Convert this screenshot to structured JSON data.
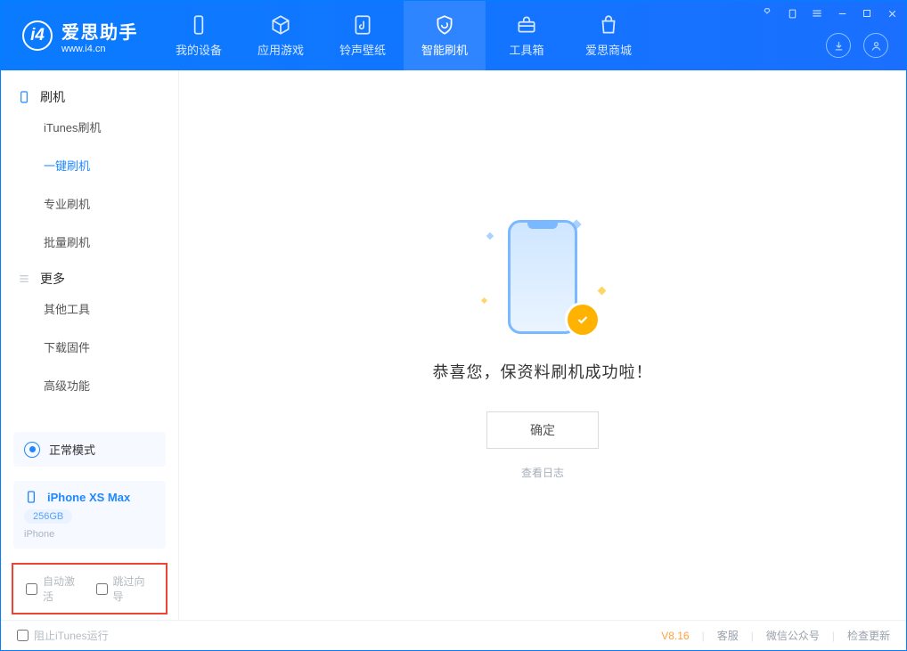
{
  "app": {
    "title": "爱思助手",
    "url": "www.i4.cn"
  },
  "nav": {
    "tabs": [
      {
        "label": "我的设备",
        "icon": "device"
      },
      {
        "label": "应用游戏",
        "icon": "cube"
      },
      {
        "label": "铃声壁纸",
        "icon": "music"
      },
      {
        "label": "智能刷机",
        "icon": "shield"
      },
      {
        "label": "工具箱",
        "icon": "toolbox"
      },
      {
        "label": "爱思商城",
        "icon": "bag"
      }
    ],
    "active_index": 3
  },
  "sidebar": {
    "groups": [
      {
        "title": "刷机",
        "items": [
          "iTunes刷机",
          "一键刷机",
          "专业刷机",
          "批量刷机"
        ],
        "active_index": 1
      },
      {
        "title": "更多",
        "items": [
          "其他工具",
          "下载固件",
          "高级功能"
        ],
        "active_index": -1
      }
    ],
    "mode": {
      "label": "正常模式"
    },
    "device": {
      "name": "iPhone XS Max",
      "storage": "256GB",
      "type": "iPhone"
    },
    "options": {
      "auto_activate": "自动激活",
      "skip_guide": "跳过向导"
    }
  },
  "main": {
    "success_text": "恭喜您，保资料刷机成功啦！",
    "ok_button": "确定",
    "view_log": "查看日志"
  },
  "footer": {
    "itunes_block": "阻止iTunes运行",
    "version": "V8.16",
    "links": [
      "客服",
      "微信公众号",
      "检查更新"
    ]
  },
  "colors": {
    "primary": "#007fff",
    "accent": "#ffb300"
  }
}
